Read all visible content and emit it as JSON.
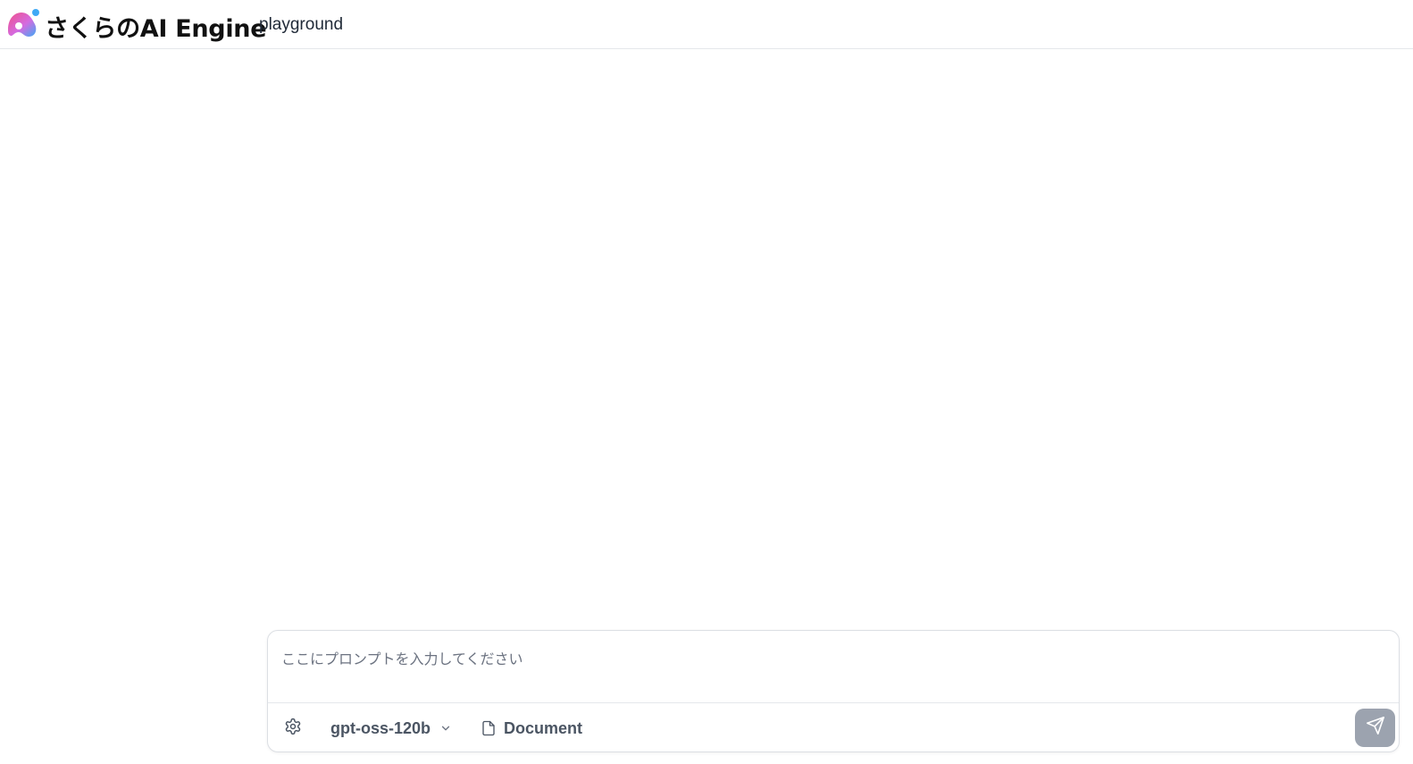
{
  "header": {
    "brand_name": "さくらのAI Engine",
    "brand_sub": "playground"
  },
  "composer": {
    "placeholder": "ここにプロンプトを入力してください",
    "model_label": "gpt-oss-120b",
    "document_label": "Document"
  },
  "icons": {
    "logo": "sakura-logo-icon",
    "settings": "gear-icon",
    "model_dropdown": "chevron-down-icon",
    "document": "document-icon",
    "send": "send-icon"
  },
  "colors": {
    "logo_pink": "#f0508a",
    "logo_blue": "#3fa9f5",
    "send_button": "#9ca3af",
    "toolbar_text": "#4b5563"
  }
}
